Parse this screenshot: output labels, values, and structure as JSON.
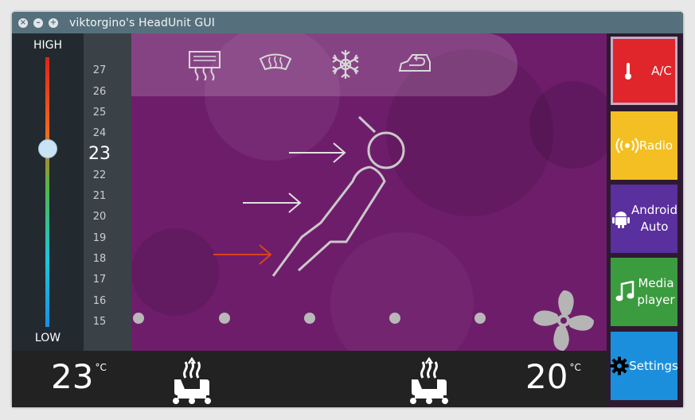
{
  "window": {
    "title": "viktorgino's HeadUnit GUI"
  },
  "left_panel": {
    "high_label": "HIGH",
    "low_label": "LOW",
    "level": 0.34
  },
  "scale": {
    "ticks": [
      "27",
      "26",
      "25",
      "24",
      "23",
      "22",
      "21",
      "20",
      "19",
      "18",
      "17",
      "16",
      "15"
    ],
    "current": "23"
  },
  "top_controls": [
    {
      "icon": "rear-defrost-icon"
    },
    {
      "icon": "windshield-defrost-icon"
    },
    {
      "icon": "snowflake-ac-icon"
    },
    {
      "icon": "air-recirculation-icon"
    }
  ],
  "bottom": {
    "left_temp": "23",
    "left_unit": "°C",
    "right_temp": "20",
    "right_unit": "°C"
  },
  "menu": [
    {
      "label_lines": [
        "A/C"
      ],
      "icon": "thermometer-icon",
      "color": "#e0262a",
      "active": true
    },
    {
      "label_lines": [
        "Radio"
      ],
      "icon": "radio-icon",
      "color": "#f4bf22",
      "active": false
    },
    {
      "label_lines": [
        "Android",
        "Auto"
      ],
      "icon": "android-icon",
      "color": "#5a2f9e",
      "active": false
    },
    {
      "label_lines": [
        "Media",
        "player"
      ],
      "icon": "music-note-icon",
      "color": "#3b9b3f",
      "active": false
    },
    {
      "label_lines": [
        "Settings"
      ],
      "icon": "gear-icon",
      "color": "#1c8fdc",
      "active": false
    }
  ],
  "colors": {
    "climate_bg": "#6e1d6b",
    "airflow_arrow_active": "#d8431e",
    "airflow_arrow": "#e0e0e0"
  }
}
